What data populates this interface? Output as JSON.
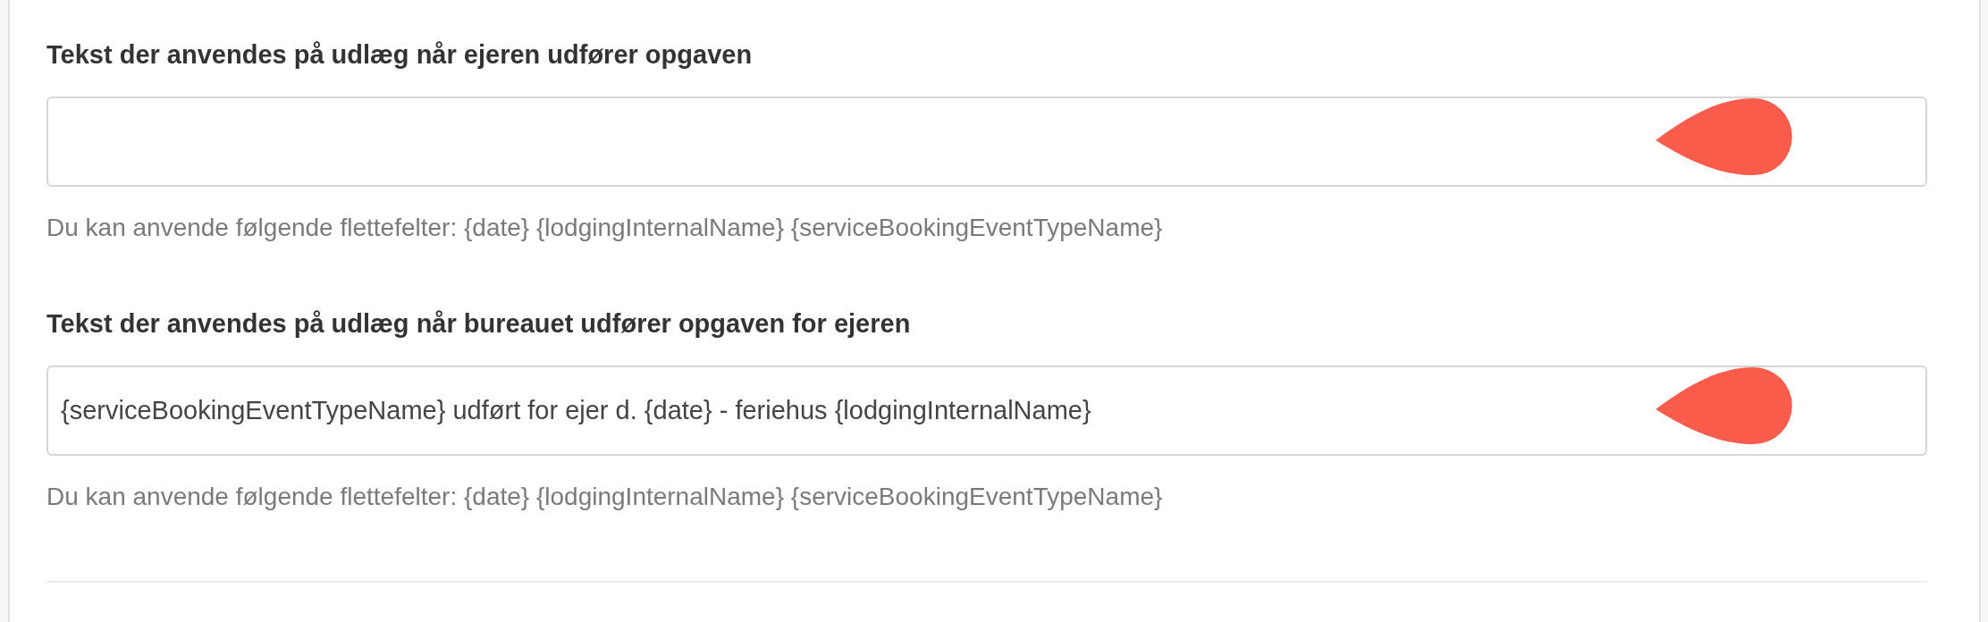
{
  "fields": [
    {
      "label": "Tekst der anvendes på udlæg når ejeren udfører opgaven",
      "help": "Du kan anvende følgende flettefelter: {date} {lodgingInternalName} {serviceBookingEventTypeName}",
      "marked": true
    },
    {
      "label": "Tekst der anvendes på udlæg når bureauet udfører opgaven for ejeren",
      "value": "{serviceBookingEventTypeName} udført for ejer d. {date} - feriehus {lodgingInternalName}",
      "help": "Du kan anvende følgende flettefelter: {date} {lodgingInternalName} {serviceBookingEventTypeName}",
      "marked": true
    }
  ]
}
